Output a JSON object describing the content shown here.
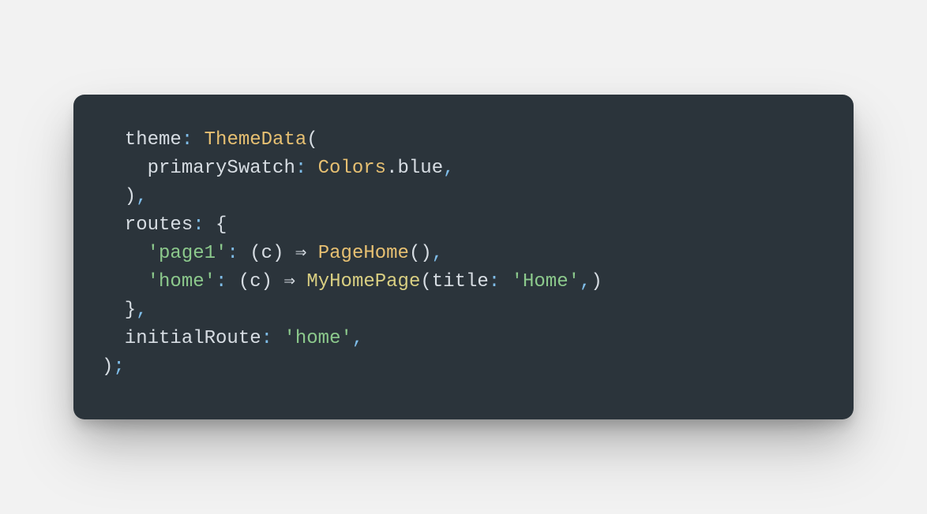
{
  "code": {
    "lines": [
      [
        {
          "cls": "tok-ident",
          "txt": "  theme"
        },
        {
          "cls": "tok-colon",
          "txt": ": "
        },
        {
          "cls": "tok-class",
          "txt": "ThemeData"
        },
        {
          "cls": "tok-punc",
          "txt": "("
        }
      ],
      [
        {
          "cls": "tok-ident",
          "txt": "    primarySwatch"
        },
        {
          "cls": "tok-colon",
          "txt": ": "
        },
        {
          "cls": "tok-class",
          "txt": "Colors"
        },
        {
          "cls": "tok-dot",
          "txt": "."
        },
        {
          "cls": "tok-ident",
          "txt": "blue"
        },
        {
          "cls": "tok-comma",
          "txt": ","
        }
      ],
      [
        {
          "cls": "tok-punc",
          "txt": "  )"
        },
        {
          "cls": "tok-comma",
          "txt": ","
        }
      ],
      [
        {
          "cls": "tok-ident",
          "txt": "  routes"
        },
        {
          "cls": "tok-colon",
          "txt": ": "
        },
        {
          "cls": "tok-punc",
          "txt": "{"
        }
      ],
      [
        {
          "cls": "tok-punc",
          "txt": "    "
        },
        {
          "cls": "tok-string",
          "txt": "'page1'"
        },
        {
          "cls": "tok-colon",
          "txt": ": "
        },
        {
          "cls": "tok-punc",
          "txt": "("
        },
        {
          "cls": "tok-ident",
          "txt": "c"
        },
        {
          "cls": "tok-punc",
          "txt": ") "
        },
        {
          "cls": "tok-arrow",
          "txt": "⇒ "
        },
        {
          "cls": "tok-class",
          "txt": "PageHome"
        },
        {
          "cls": "tok-punc",
          "txt": "()"
        },
        {
          "cls": "tok-comma",
          "txt": ","
        }
      ],
      [
        {
          "cls": "tok-punc",
          "txt": "    "
        },
        {
          "cls": "tok-string",
          "txt": "'home'"
        },
        {
          "cls": "tok-colon",
          "txt": ": "
        },
        {
          "cls": "tok-punc",
          "txt": "("
        },
        {
          "cls": "tok-ident",
          "txt": "c"
        },
        {
          "cls": "tok-punc",
          "txt": ") "
        },
        {
          "cls": "tok-arrow",
          "txt": "⇒ "
        },
        {
          "cls": "tok-classY",
          "txt": "MyHomePage"
        },
        {
          "cls": "tok-punc",
          "txt": "("
        },
        {
          "cls": "tok-ident",
          "txt": "title"
        },
        {
          "cls": "tok-colon",
          "txt": ": "
        },
        {
          "cls": "tok-string",
          "txt": "'Home'"
        },
        {
          "cls": "tok-comma",
          "txt": ","
        },
        {
          "cls": "tok-punc",
          "txt": ")"
        }
      ],
      [
        {
          "cls": "tok-punc",
          "txt": "  }"
        },
        {
          "cls": "tok-comma",
          "txt": ","
        }
      ],
      [
        {
          "cls": "tok-ident",
          "txt": "  initialRoute"
        },
        {
          "cls": "tok-colon",
          "txt": ": "
        },
        {
          "cls": "tok-string",
          "txt": "'home'"
        },
        {
          "cls": "tok-comma",
          "txt": ","
        }
      ],
      [
        {
          "cls": "tok-punc",
          "txt": ")"
        },
        {
          "cls": "tok-semi",
          "txt": ";"
        }
      ]
    ]
  }
}
